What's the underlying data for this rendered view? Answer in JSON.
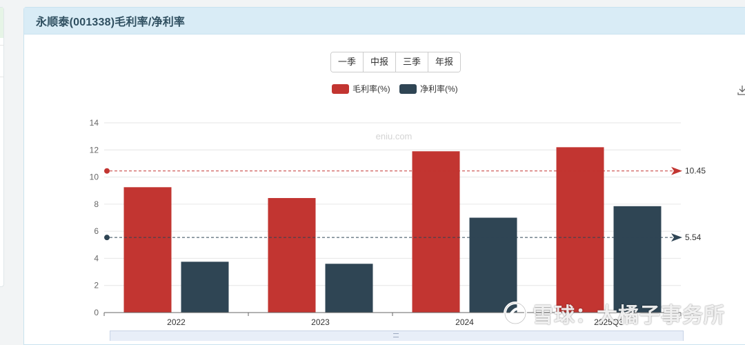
{
  "panel": {
    "title": "永顺泰(001338)毛利率/净利率"
  },
  "period_buttons": [
    "一季",
    "中报",
    "三季",
    "年报"
  ],
  "watermark": {
    "site": "eniu.com",
    "brand": "雪球：大橘子事务所"
  },
  "colors": {
    "gross": "#c23531",
    "net": "#2f4554"
  },
  "chart_data": {
    "type": "bar",
    "title": "",
    "xlabel": "",
    "ylabel": "",
    "categories": [
      "2022",
      "2023",
      "2024",
      "2025Q3"
    ],
    "series": [
      {
        "name": "毛利率(%)",
        "color": "#c23531",
        "values": [
          9.25,
          8.45,
          11.9,
          12.2
        ]
      },
      {
        "name": "净利率(%)",
        "color": "#2f4554",
        "values": [
          3.75,
          3.6,
          7.0,
          7.85
        ]
      }
    ],
    "mark_lines": [
      {
        "series": "毛利率(%)",
        "label": "10.45",
        "value": 10.45,
        "color": "#c23531"
      },
      {
        "series": "净利率(%)",
        "label": "5.54",
        "value": 5.54,
        "color": "#2f4554"
      }
    ],
    "ylim": [
      0,
      14
    ],
    "yticks": [
      0,
      2,
      4,
      6,
      8,
      10,
      12,
      14
    ],
    "legend": "top-center",
    "grid": true
  }
}
